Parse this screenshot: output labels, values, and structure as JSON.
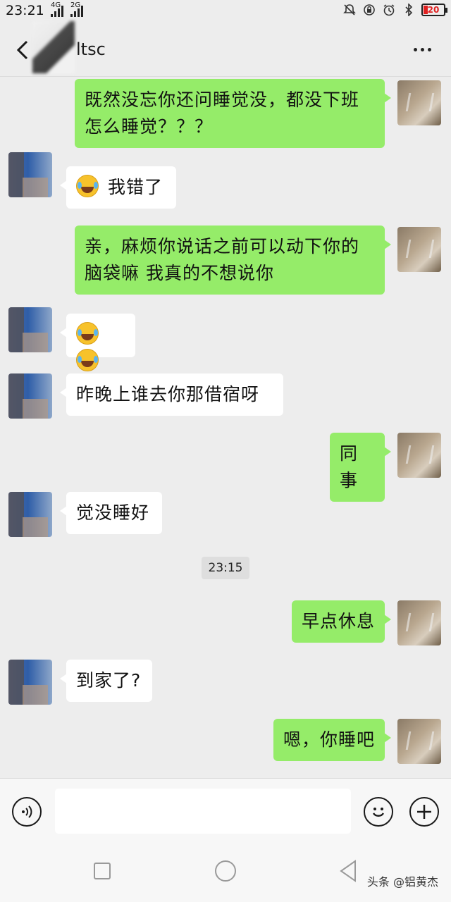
{
  "status_bar": {
    "time": "23:21",
    "net1": "4G",
    "net2": "2G",
    "battery": "20",
    "icons": [
      "bell-off-icon",
      "alarm-lock-icon",
      "alarm-clock-icon",
      "bluetooth-icon"
    ]
  },
  "header": {
    "title": "ltsc",
    "back_icon": "chevron-left-icon",
    "more_icon": "more-dots-icon"
  },
  "messages": [
    {
      "sender": "me",
      "text": "既然没忘你还问睡觉没，都没下班怎么睡觉？？？"
    },
    {
      "sender": "other",
      "emoji": "crying-face-emoji",
      "text": "我错了"
    },
    {
      "sender": "me",
      "text": "亲，麻烦你说话之前可以动下你的脑袋嘛 我真的不想说你"
    },
    {
      "sender": "other",
      "emoji": "joy-emoji-x2",
      "text": ""
    },
    {
      "sender": "other",
      "text": "昨晚上谁去你那借宿呀"
    },
    {
      "sender": "me",
      "text": "同事"
    },
    {
      "sender": "other",
      "text": "觉没睡好"
    },
    {
      "sender": "me",
      "text": "早点休息"
    },
    {
      "sender": "other",
      "text": "到家了?"
    },
    {
      "sender": "me",
      "text": "嗯，你睡吧"
    }
  ],
  "timestamp": "23:15",
  "input_bar": {
    "voice_icon": "voice-icon",
    "placeholder": "",
    "emoji_icon": "smiley-icon",
    "plus_icon": "plus-icon"
  },
  "nav": {
    "watermark": "头条 @铝黄杰"
  },
  "colors": {
    "my_bubble": "#95ec69",
    "other_bubble": "#ffffff",
    "background": "#ededed"
  }
}
